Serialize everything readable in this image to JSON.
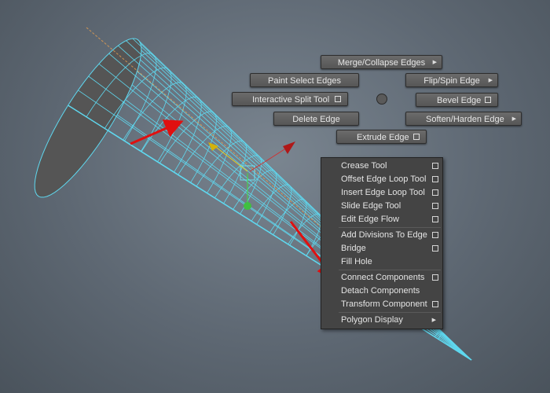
{
  "marking_menu": {
    "north": {
      "label": "Merge/Collapse Edges",
      "submenu": true
    },
    "northwest": {
      "label": "Paint Select Edges"
    },
    "northeast": {
      "label": "Flip/Spin Edge",
      "submenu": true
    },
    "west": {
      "label": "Interactive Split Tool",
      "option_box": true
    },
    "east": {
      "label": "Bevel Edge",
      "option_box": true
    },
    "southwest": {
      "label": "Delete Edge"
    },
    "southeast": {
      "label": "Soften/Harden Edge",
      "submenu": true
    },
    "south": {
      "label": "Extrude Edge",
      "option_box": true
    }
  },
  "context_menu": {
    "items": [
      {
        "label": "Crease Tool",
        "option_box": true
      },
      {
        "label": "Offset Edge Loop Tool",
        "option_box": true
      },
      {
        "label": "Insert Edge Loop Tool",
        "option_box": true
      },
      {
        "label": "Slide Edge Tool",
        "option_box": true
      },
      {
        "label": "Edit Edge Flow",
        "option_box": true
      },
      {
        "label": "Add Divisions To Edge",
        "option_box": true
      },
      {
        "label": "Bridge",
        "option_box": true
      },
      {
        "label": "Fill Hole",
        "option_box": false
      },
      {
        "label": "Connect Components",
        "option_box": true
      },
      {
        "label": "Detach Components",
        "option_box": false
      },
      {
        "label": "Transform Component",
        "option_box": true
      },
      {
        "label": "Polygon Display",
        "submenu": true
      }
    ]
  },
  "colors": {
    "wireframe": "#5fd8ef",
    "mesh_fill": "#555555",
    "annotation_arrow": "#e01010",
    "menu_bg": "#444444"
  }
}
